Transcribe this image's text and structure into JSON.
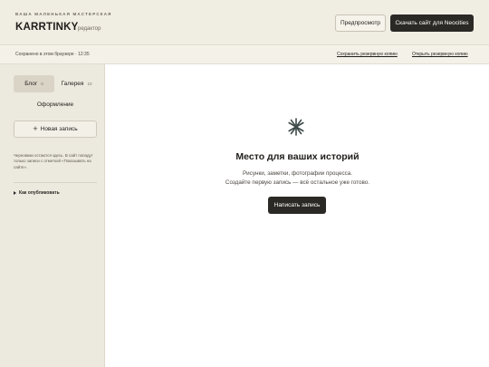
{
  "header": {
    "tagline": "ВАША МАЛЕНЬКАЯ МАСТЕРСКАЯ",
    "brand": "KARRTINKY",
    "brand_sub": "редактор",
    "preview_label": "Предпросмотр",
    "download_label": "Скачать сайт для Neocities"
  },
  "status": {
    "saved_text": "Сохранено в этом браузере · 12:35",
    "save_backup": "Сохранить резервную копию",
    "open_backup": "Открыть резервную копию"
  },
  "sidebar": {
    "tabs": [
      {
        "label": "Блог",
        "count": "0"
      },
      {
        "label": "Галерея",
        "count": "10"
      }
    ],
    "design_label": "Оформление",
    "new_post_label": "Новая запись",
    "note": "Черновики остаются здесь. В сайт попадут только записи с отметкой «Показывать на сайте».",
    "howto_label": "Как опубликовать"
  },
  "main": {
    "empty_title": "Место для ваших историй",
    "empty_line1": "Рисунки, заметки, фотографии процесса.",
    "empty_line2": "Создайте первую запись — всё остальное уже готово.",
    "write_label": "Написать запись"
  },
  "colors": {
    "header_bg": "#f0ede3",
    "sidebar_bg": "#ece9df",
    "accent_dark": "#2b2925",
    "icon_color": "#3f4a4a"
  },
  "icons": {
    "empty_state": "asterisk-icon",
    "new_post": "plus-icon",
    "howto": "triangle-right-icon"
  }
}
